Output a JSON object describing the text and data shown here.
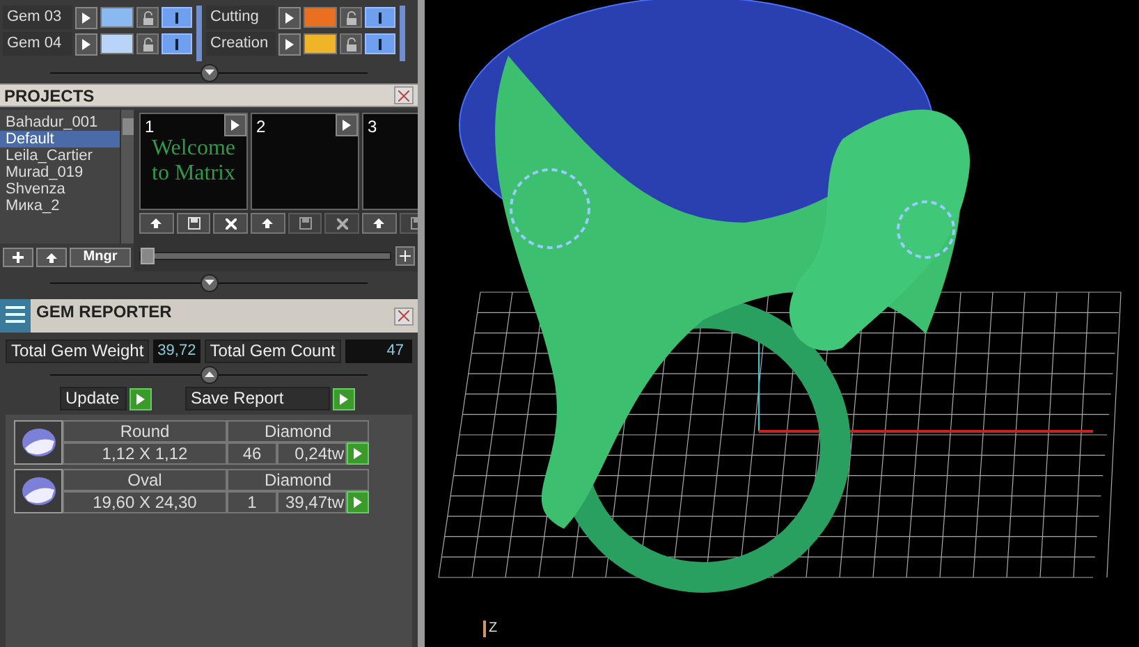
{
  "layers": [
    {
      "name": "Gem 03",
      "color": "#8ab8f0",
      "visible": true
    },
    {
      "name": "Gem 04",
      "color": "#b8d4f8",
      "visible": true
    }
  ],
  "layers_right": [
    {
      "name": "Cutting",
      "color": "#e87020",
      "visible": true
    },
    {
      "name": "Creation",
      "color": "#f0b428",
      "visible": true
    }
  ],
  "projects": {
    "title": "PROJECTS",
    "items": [
      {
        "label": "Bahadur_001",
        "selected": false
      },
      {
        "label": "Default",
        "selected": true
      },
      {
        "label": "Leila_Cartier",
        "selected": false
      },
      {
        "label": "Murad_019",
        "selected": false
      },
      {
        "label": "Shvenza",
        "selected": false
      },
      {
        "label": "Мика_2",
        "selected": false
      }
    ],
    "manager_button": "Mngr",
    "slots": [
      {
        "number": "1",
        "thumbnail_text": "Welcome to Matrix",
        "saved": true
      },
      {
        "number": "2",
        "saved": false
      },
      {
        "number": "3",
        "saved": false
      }
    ],
    "zoom_slider": {
      "level": 0
    }
  },
  "gem_reporter": {
    "title": "GEM REPORTER",
    "total_weight_label": "Total Gem Weight",
    "total_weight": "39,72",
    "total_count_label": "Total Gem Count",
    "total_count": "47",
    "update_button": "Update",
    "save_button": "Save Report",
    "gems": [
      {
        "shape": "Round",
        "material": "Diamond",
        "size": "1,12 X 1,12",
        "count": "46",
        "weight": "0,24tw"
      },
      {
        "shape": "Oval",
        "material": "Diamond",
        "size": "19,60 X 24,30",
        "count": "1",
        "weight": "39,47tw"
      }
    ]
  },
  "viewport": {
    "axis_label": "Z"
  }
}
